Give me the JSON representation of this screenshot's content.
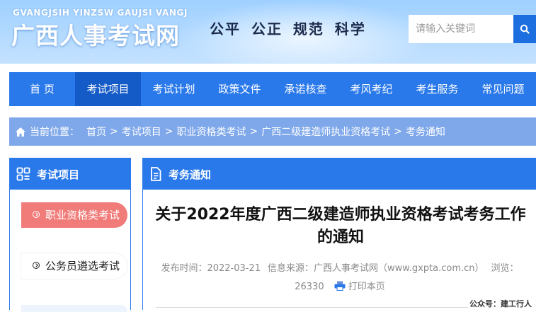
{
  "header": {
    "logo_en": "GVANGJSIH YINZSW GAUJSI VANGJ",
    "logo_cn": "广西人事考试网",
    "slogan": "公平  公正  规范  科学",
    "search_placeholder": "请输入关键词",
    "search_icon": "search-icon"
  },
  "nav": {
    "items": [
      "首 页",
      "考试项目",
      "考试计划",
      "政策文件",
      "承诺核查",
      "考风考纪",
      "考生服务",
      "常见问题"
    ],
    "active_index": 1
  },
  "breadcrumb": {
    "prefix": "当前位置：",
    "items": [
      "首页",
      "考试项目",
      "职业资格类考试",
      "广西二级建造师执业资格考试",
      "考务通知"
    ],
    "separator": ">"
  },
  "sidebar": {
    "title": "考试项目",
    "items": [
      "职业资格类考试",
      "公务员遴选考试"
    ],
    "active_index": 0
  },
  "main": {
    "header": "考务通知",
    "title": "关于2022年度广西二级建造师执业资格考试考务工作的通知",
    "meta": {
      "publish_label": "发布时间：",
      "publish_date": "2022-03-21",
      "source_label": "信息来源：",
      "source": "广西人事考试网（www.gxpta.com.cn）",
      "views_label": "浏览：",
      "views": "26330",
      "print_label": "打印本页"
    }
  },
  "watermark": "公众号：建工行人",
  "colors": {
    "primary": "#2a79ea",
    "nav_active": "#155bc7",
    "breadcrumb_bg": "#7fa8ea",
    "sidebar_active": "#f07b78"
  }
}
